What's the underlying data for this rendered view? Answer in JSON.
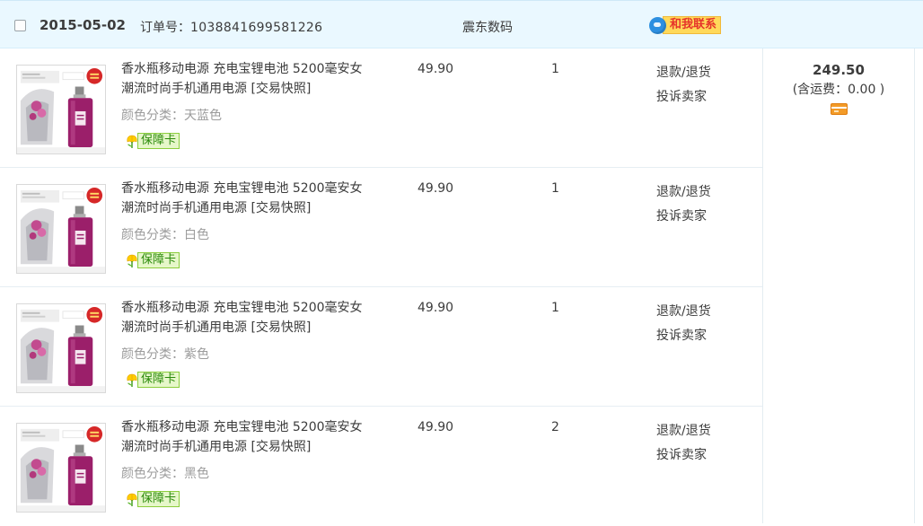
{
  "order": {
    "date": "2015-05-02",
    "order_no_label": "订单号：",
    "order_no": "1038841699581226",
    "shop": "震东数码",
    "contact_label": "和我联系"
  },
  "items": [
    {
      "title": "香水瓶移动电源 充电宝锂电池 5200毫安女潮流时尚手机通用电源 [交易快照]",
      "attr_label": "颜色分类：",
      "attr_value": "天蓝色",
      "warranty": "保障卡",
      "price": "49.90",
      "qty": "1",
      "op1": "退款/退货",
      "op2": "投诉卖家"
    },
    {
      "title": "香水瓶移动电源 充电宝锂电池 5200毫安女潮流时尚手机通用电源 [交易快照]",
      "attr_label": "颜色分类：",
      "attr_value": "白色",
      "warranty": "保障卡",
      "price": "49.90",
      "qty": "1",
      "op1": "退款/退货",
      "op2": "投诉卖家"
    },
    {
      "title": "香水瓶移动电源 充电宝锂电池 5200毫安女潮流时尚手机通用电源 [交易快照]",
      "attr_label": "颜色分类：",
      "attr_value": "紫色",
      "warranty": "保障卡",
      "price": "49.90",
      "qty": "1",
      "op1": "退款/退货",
      "op2": "投诉卖家"
    },
    {
      "title": "香水瓶移动电源 充电宝锂电池 5200毫安女潮流时尚手机通用电源 [交易快照]",
      "attr_label": "颜色分类：",
      "attr_value": "黑色",
      "warranty": "保障卡",
      "price": "49.90",
      "qty": "2",
      "op1": "退款/退货",
      "op2": "投诉卖家"
    }
  ],
  "total": {
    "amount": "249.50",
    "shipping": "(含运费：0.00 )"
  },
  "icons": {
    "checkbox": "checkbox-icon",
    "chat": "chat-icon",
    "warranty": "tulip-icon",
    "payment": "card-icon"
  },
  "colors": {
    "header_bg": "#eaf8ff",
    "contact_bg": "#ffd95a",
    "contact_text": "#e6332a",
    "warranty_green": "#2a8a0a",
    "product_purple": "#9b1f6a"
  }
}
